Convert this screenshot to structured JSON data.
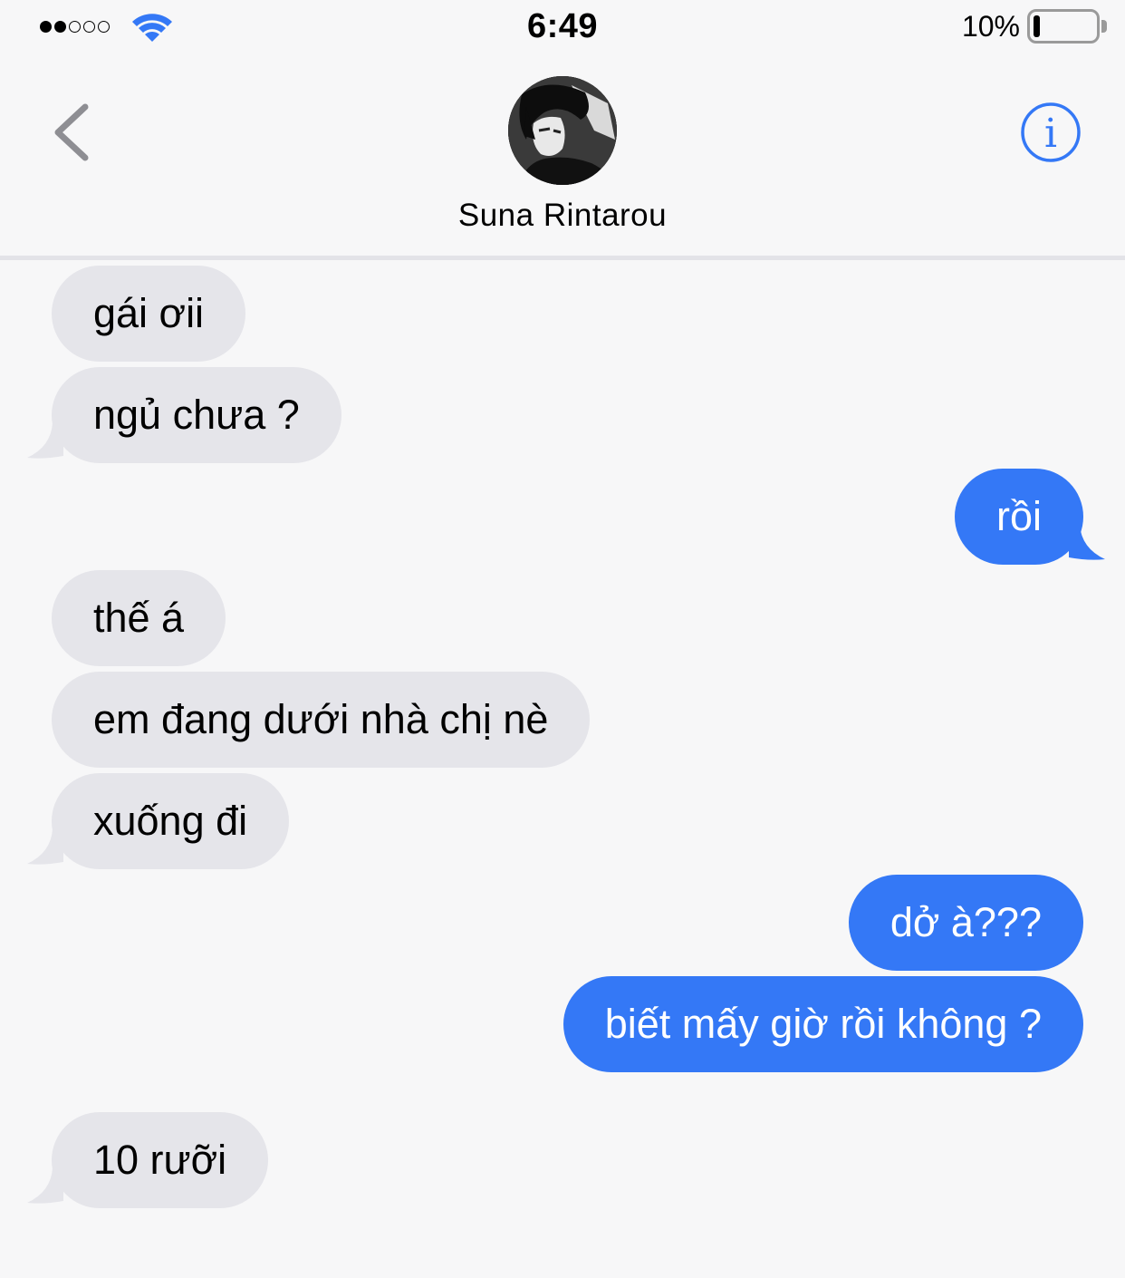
{
  "status_bar": {
    "time": "6:49",
    "battery_percent_label": "10%",
    "battery_level": 0.1,
    "signal_bars_total": 5,
    "signal_bars_filled": 2,
    "wifi_icon": "wifi-icon"
  },
  "header": {
    "contact_name": "Suna Rintarou",
    "back_icon": "chevron-left-icon",
    "info_icon": "info-icon",
    "accent_color": "#3478f6"
  },
  "messages": [
    {
      "direction": "in",
      "text": "gái ơii"
    },
    {
      "direction": "in",
      "text": "ngủ chưa ?"
    },
    {
      "direction": "out",
      "text": "rồi"
    },
    {
      "direction": "in",
      "text": "thế á"
    },
    {
      "direction": "in",
      "text": "em đang dưới nhà chị nè"
    },
    {
      "direction": "in",
      "text": "xuống đi"
    },
    {
      "direction": "out",
      "text": "dở à???"
    },
    {
      "direction": "out",
      "text": "biết mấy giờ rồi không ?"
    },
    {
      "direction": "in",
      "text": "10 rưỡi"
    }
  ],
  "colors": {
    "incoming_bubble": "#e5e5ea",
    "outgoing_bubble": "#3478f6",
    "background": "#f7f7f8"
  }
}
